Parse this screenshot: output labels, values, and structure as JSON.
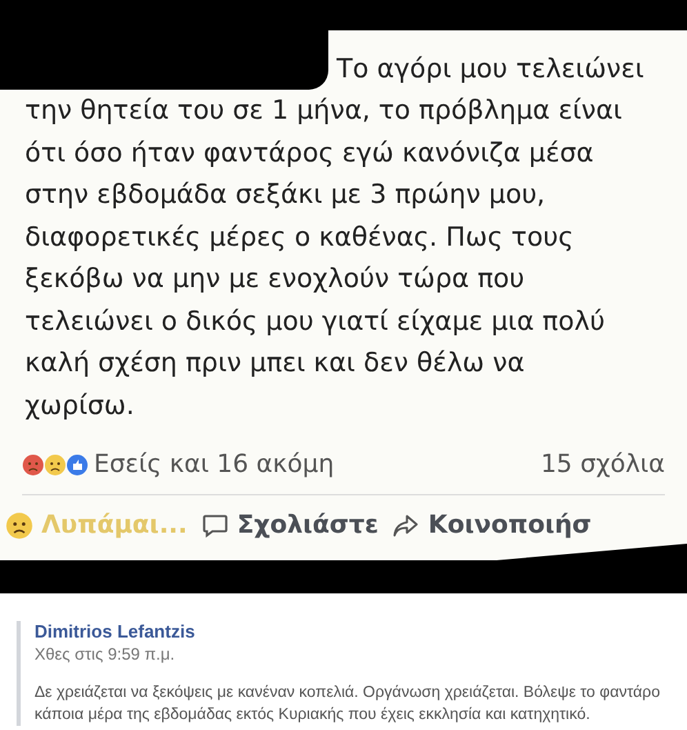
{
  "post_image": {
    "lines": [
      "Το αγόρι μου τελειώνει",
      "την θητεία του σε 1 μήνα, το πρόβλημα είναι",
      "ότι όσο ήταν φαντάρος εγώ κανόνιζα μέσα",
      "στην εβδομάδα σεξάκι με 3 πρώην μου,",
      "διαφορετικές μέρες ο καθένας. Πως τους",
      "ξεκόβω να μην με ενοχλούν τώρα που",
      "τελειώνει ο δικός μου γιατί είχαμε μια πολύ",
      "καλή σχέση πριν μπει και δεν θέλω να",
      "χωρίσω."
    ],
    "reactions": "Εσείς και 16 ακόμη",
    "comments_count": "15 σχόλια",
    "actions": [
      {
        "kind": "reaction",
        "label": "Λυπάμαι..."
      },
      {
        "kind": "comment",
        "label": "Σχολιάστε"
      },
      {
        "kind": "share",
        "label": "Κοινοποιήσ"
      }
    ]
  },
  "comment": {
    "author": "Dimitrios Lefantzis",
    "time": "Χθες στις 9:59 π.μ.",
    "text": "Δε χρειάζεται να ξεκόψεις με κανέναν κοπελιά. Οργάνωση χρειάζεται. Βόλεψε το φαντάρο κάποια μέρα της εβδομάδας εκτός Κυριακής που έχεις εκκλησία και κατηχητικό."
  }
}
